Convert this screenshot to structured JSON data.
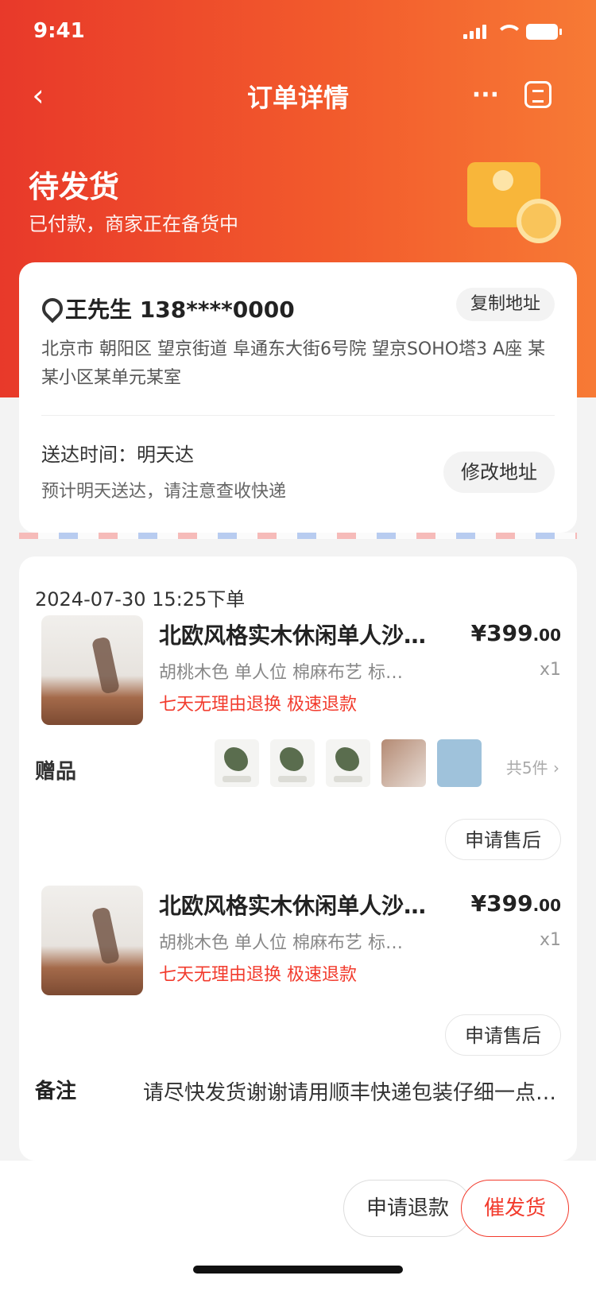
{
  "status_bar": {
    "time": "9:41"
  },
  "nav": {
    "title": "订单详情",
    "back_icon": "chevron-left-icon",
    "more_label": "···",
    "service_icon": "customer-service-icon"
  },
  "order_status": {
    "title": "待发货",
    "subtitle": "已付款，商家正在备货中"
  },
  "address": {
    "head": "王先生  138****0000",
    "copy_label": "复制地址",
    "detail": "北京市 朝阳区 望京街道 阜通东大街6号院 望京SOHO塔3 A座 某某小区某单元某室",
    "delivery_time": "送达时间：明天达",
    "delivery_note": "预计明天送达，请注意查收快递",
    "modify_label": "修改地址"
  },
  "order": {
    "time": "2024-07-30 15:25下单",
    "products": [
      {
        "title": "北欧风格实木休闲单人沙发椅客厅阳台",
        "spec": "胡桃木色 单人位 棉麻布艺 标准款",
        "tag": "七天无理由退换 极速退款",
        "price": "¥399",
        "price_suffix": ".00",
        "qty": "x1"
      },
      {
        "title": "北欧风格实木休闲单人沙发椅客厅阳台",
        "spec": "胡桃木色 单人位 棉麻布艺 标准款",
        "tag": "七天无理由退换 极速退款",
        "price": "¥399",
        "price_suffix": ".00",
        "qty": "x1"
      }
    ],
    "gift": {
      "label": "赠品",
      "more": "共5件 ›"
    },
    "apply_label_1": "申请售后",
    "apply_label_2": "申请售后",
    "remark": {
      "label": "备注",
      "text": "请尽快发货谢谢请用顺丰快递包装仔细一点谢谢"
    }
  },
  "bottom": {
    "secondary_label": "申请退款",
    "primary_label": "催发货"
  },
  "colors": {
    "brand_red": "#e8392a",
    "brand_orange": "#f77a35",
    "accent_text": "#f23b2d"
  }
}
